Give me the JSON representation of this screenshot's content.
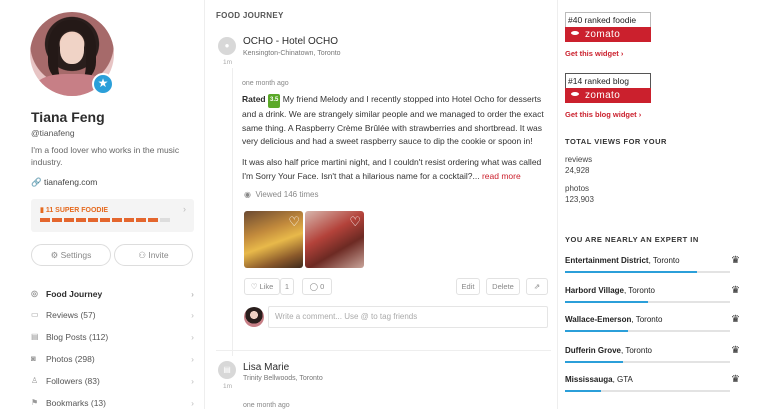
{
  "profile": {
    "name": "Tiana Feng",
    "handle": "@tianafeng",
    "bio": "I'm a food lover who works in the music industry.",
    "website": "tianafeng.com",
    "foodie_level": "11 SUPER FOODIE",
    "foodie_progress_segments": 11,
    "foodie_progress_filled": 10,
    "settings_label": "Settings",
    "invite_label": "Invite"
  },
  "nav": [
    {
      "label": "Food Journey",
      "icon": "journey-icon"
    },
    {
      "label": "Reviews (57)",
      "icon": "reviews-icon"
    },
    {
      "label": "Blog Posts (112)",
      "icon": "blog-icon"
    },
    {
      "label": "Photos (298)",
      "icon": "camera-icon"
    },
    {
      "label": "Followers (83)",
      "icon": "user-icon"
    },
    {
      "label": "Bookmarks (13)",
      "icon": "bookmark-icon"
    }
  ],
  "feed": {
    "title": "FOOD JOURNEY",
    "post1": {
      "time": "1m",
      "title": "OCHO - Hotel OCHO",
      "subtitle": "Kensington-Chinatown, Toronto",
      "when": "one month ago",
      "rated_label": "Rated",
      "rating": "3.5",
      "text1": "My friend Melody and I recently stopped into Hotel Ocho for desserts and a drink. We are strangely similar people and we managed to order the exact same thing. A Raspberry Crème Brûlée with strawberries and shortbread. It was very delicious and had a sweet raspberry sauce to dip the cookie or spoon in!",
      "text2": "It was also half price martini night, and I couldn't resist ordering what was called I'm Sorry Your Face. Isn't that a hilarious name for a cocktail?...",
      "more": "read more",
      "viewed": "Viewed 146 times",
      "like_label": "Like",
      "like_count": "1",
      "comment_count": "0",
      "edit_label": "Edit",
      "delete_label": "Delete",
      "comment_placeholder": "Write a comment... Use @ to tag friends"
    },
    "post2": {
      "time": "1m",
      "title": "Lisa Marie",
      "subtitle": "Trinity Bellwoods, Toronto",
      "when": "one month ago"
    }
  },
  "sidebar": {
    "widget1_rank": "#40 ranked foodie",
    "widget1_brand": "zomato",
    "widget1_link": "Get this widget ›",
    "widget2_rank": "#14 ranked blog",
    "widget2_brand": "zomato",
    "widget2_link": "Get this blog widget ›",
    "views_title": "TOTAL VIEWS FOR YOUR",
    "reviews_label": "reviews",
    "reviews_value": "24,928",
    "photos_label": "photos",
    "photos_value": "123,903",
    "expert_title": "YOU ARE NEARLY AN EXPERT IN",
    "experts": [
      {
        "area": "Entertainment District",
        "city": ", Toronto",
        "progress": 0.8
      },
      {
        "area": "Harbord Village",
        "city": ", Toronto",
        "progress": 0.5
      },
      {
        "area": "Wallace-Emerson",
        "city": ", Toronto",
        "progress": 0.38
      },
      {
        "area": "Dufferin Grove",
        "city": ", Toronto",
        "progress": 0.35
      },
      {
        "area": "Mississauga",
        "city": ", GTA",
        "progress": 0.22
      }
    ]
  },
  "colors": {
    "accent": "#cb202d",
    "badge": "#2b9fd9",
    "foodie": "#e4662e",
    "rating": "#5ba829"
  }
}
